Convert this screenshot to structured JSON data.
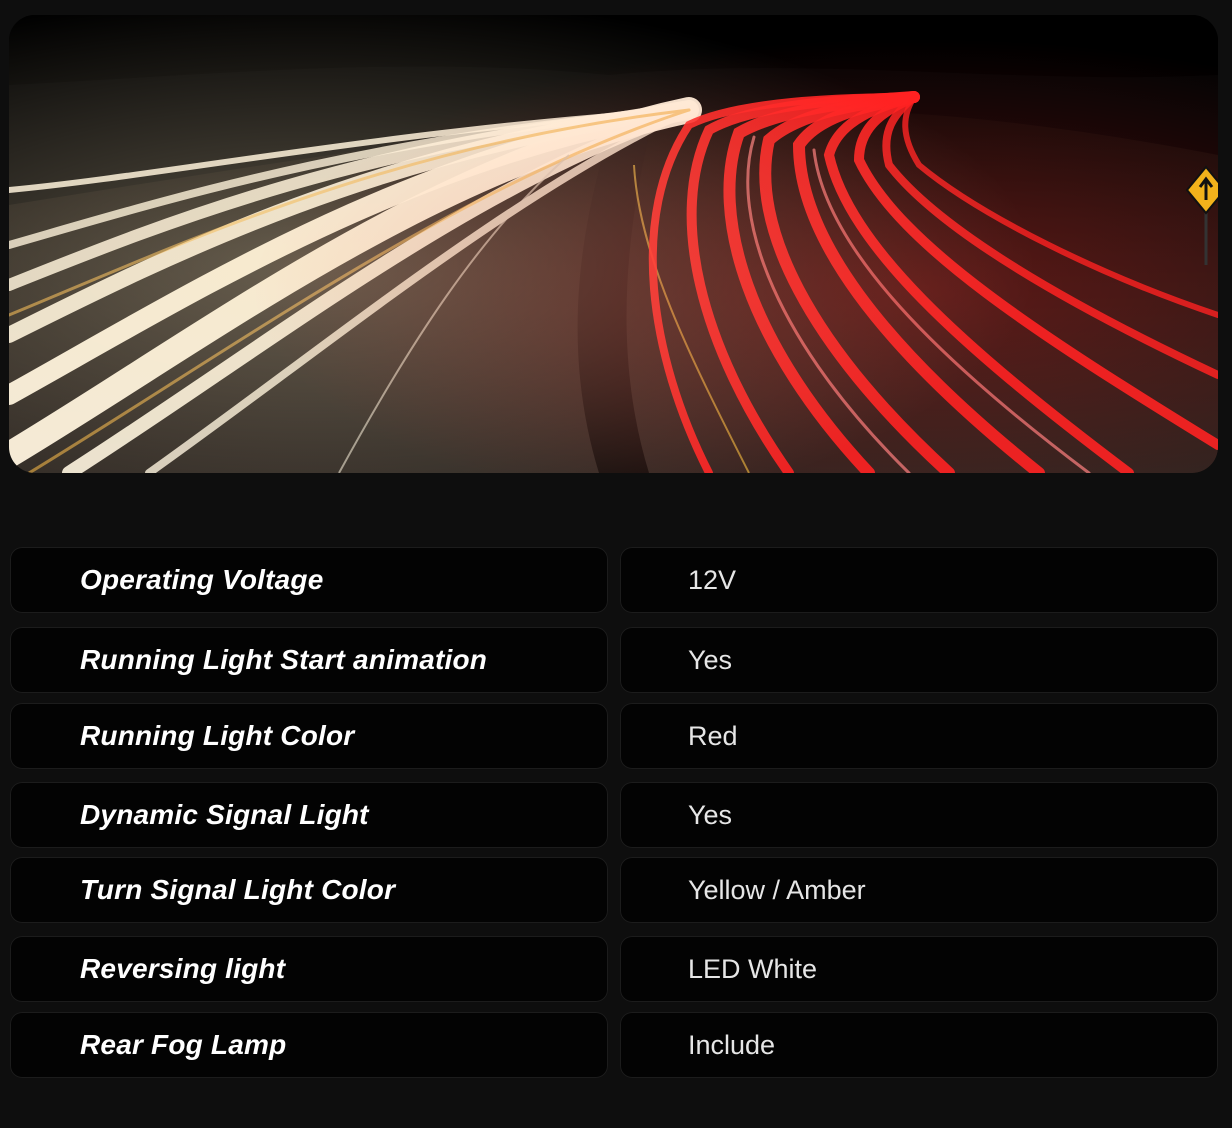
{
  "hero": {
    "image": "long-exposure highway at night with white headlight and red taillight streaks",
    "colors": {
      "sky": "#050505",
      "road": "#1a1613",
      "headlights": "#fff4dc",
      "taillights": "#ff1e1e",
      "sign": "#f2b21b"
    }
  },
  "specs": [
    {
      "label": "Operating Voltage",
      "value": "12V"
    },
    {
      "label": "Running Light Start animation",
      "value": "Yes"
    },
    {
      "label": "Running Light Color",
      "value": "Red"
    },
    {
      "label": "Dynamic Signal Light",
      "value": "Yes"
    },
    {
      "label": "Turn Signal Light Color",
      "value": "Yellow / Amber"
    },
    {
      "label": "Reversing light",
      "value": "LED White"
    },
    {
      "label": "Rear Fog Lamp",
      "value": "Include"
    }
  ]
}
